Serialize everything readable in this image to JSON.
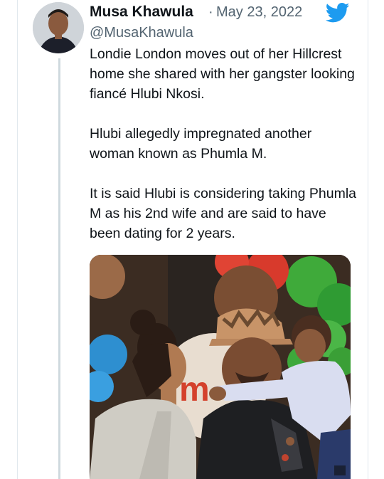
{
  "tweet": {
    "display_name": "Musa Khawula",
    "separator": "·",
    "date": "May 23, 2022",
    "handle": "@MusaKhawula",
    "paragraphs": [
      "Londie London moves out of her Hillcrest home she shared with her gangster looking fiancé Hlubi Nkosi.",
      "Hlubi allegedly impregnated another woman known as Phumla M.",
      "It is said Hlubi is considering taking Phumla M as his 2nd wife and are said to have been dating for 2 years."
    ]
  },
  "icons": {
    "brand": "twitter-bird-icon",
    "brand_color": "#1d9bf0"
  }
}
